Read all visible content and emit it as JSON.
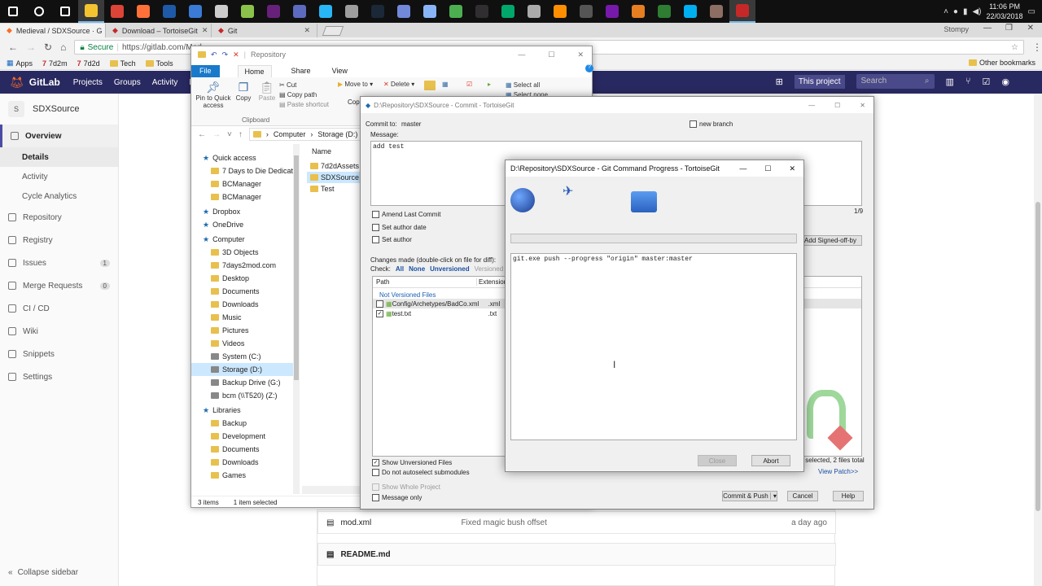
{
  "taskbar": {
    "icons": [
      {
        "name": "start-icon",
        "color": "#ffffff"
      },
      {
        "name": "search-icon",
        "color": "#ffffff"
      },
      {
        "name": "task-view-icon",
        "color": "#ffffff"
      },
      {
        "name": "file-explorer-icon",
        "color": "#f4c430"
      },
      {
        "name": "chrome-icon",
        "color": "#db4437"
      },
      {
        "name": "firefox-icon",
        "color": "#ff7139"
      },
      {
        "name": "app-blue-icon",
        "color": "#1e5aa8"
      },
      {
        "name": "thunderbird-icon",
        "color": "#3a7bd5"
      },
      {
        "name": "calculator-icon",
        "color": "#cccccc"
      },
      {
        "name": "notepad-plus-icon",
        "color": "#8bc34a"
      },
      {
        "name": "visual-studio-icon",
        "color": "#68217a"
      },
      {
        "name": "app-indigo-icon",
        "color": "#5c6bc0"
      },
      {
        "name": "app-cyan-icon",
        "color": "#29b6f6"
      },
      {
        "name": "app-grey-icon",
        "color": "#9e9e9e"
      },
      {
        "name": "steam-icon",
        "color": "#1b2838"
      },
      {
        "name": "discord-icon",
        "color": "#7289da"
      },
      {
        "name": "app-plane-icon",
        "color": "#8ab4f8"
      },
      {
        "name": "app-green-icon",
        "color": "#4caf50"
      },
      {
        "name": "obs-icon",
        "color": "#302e31"
      },
      {
        "name": "app-v-icon",
        "color": "#00a86b"
      },
      {
        "name": "tools-icon",
        "color": "#aaaaaa"
      },
      {
        "name": "app-orange-icon",
        "color": "#ff8f00"
      },
      {
        "name": "app-dark-icon",
        "color": "#555555"
      },
      {
        "name": "onenote-icon",
        "color": "#7719aa"
      },
      {
        "name": "app-slides-icon",
        "color": "#e67e22"
      },
      {
        "name": "app-green2-icon",
        "color": "#2e7d32"
      },
      {
        "name": "skype-icon",
        "color": "#00aff0"
      },
      {
        "name": "app-brown-icon",
        "color": "#8d6e63"
      },
      {
        "name": "tortoisegit-icon",
        "color": "#c62828"
      }
    ],
    "time": "11:06 PM",
    "date": "22/03/2018"
  },
  "browser": {
    "tabs": [
      {
        "label": "Medieval / SDXSource · G"
      },
      {
        "label": "Download – TortoiseGit"
      },
      {
        "label": "Git"
      }
    ],
    "profile": "Stompy",
    "secure_label": "Secure",
    "url": "https://gitlab.com/Med",
    "bookmarks": [
      "Apps",
      "7d2m",
      "7d2d",
      "Tech",
      "Tools"
    ],
    "other_bookmarks": "Other bookmarks"
  },
  "gitlab": {
    "brand": "GitLab",
    "nav": [
      "Projects",
      "Groups",
      "Activity",
      "Mile"
    ],
    "this_project": "This project",
    "search_placeholder": "Search",
    "project_initial": "S",
    "project_name": "SDXSource",
    "sidebar": [
      {
        "label": "Overview",
        "type": "main",
        "active": true
      },
      {
        "label": "Details",
        "type": "sub",
        "active": true
      },
      {
        "label": "Activity",
        "type": "sub"
      },
      {
        "label": "Cycle Analytics",
        "type": "sub"
      },
      {
        "label": "Repository",
        "type": "main"
      },
      {
        "label": "Registry",
        "type": "main"
      },
      {
        "label": "Issues",
        "type": "main",
        "count": "1"
      },
      {
        "label": "Merge Requests",
        "type": "main",
        "count": "0"
      },
      {
        "label": "CI / CD",
        "type": "main"
      },
      {
        "label": "Wiki",
        "type": "main"
      },
      {
        "label": "Snippets",
        "type": "main"
      },
      {
        "label": "Settings",
        "type": "main"
      }
    ],
    "collapse": "Collapse sidebar",
    "files": [
      {
        "name": "mod.xml",
        "commit": "Fixed magic bush offset",
        "time": "a day ago"
      }
    ],
    "readme": "README.md"
  },
  "explorer": {
    "title": "Repository",
    "ribbon_tabs": [
      "File",
      "Home",
      "Share",
      "View"
    ],
    "clipboard_label": "Clipboard",
    "ribbon_items": [
      "Pin to Quick access",
      "Copy",
      "Paste",
      "Cut",
      "Copy path",
      "Paste shortcut",
      "Move to",
      "Delete",
      "Select all",
      "Select none",
      "Cop"
    ],
    "path": [
      "Computer",
      "Storage (D:)",
      "R"
    ],
    "nav": [
      {
        "label": "Quick access",
        "root": true
      },
      {
        "label": "7 Days to Die Dedicate"
      },
      {
        "label": "BCManager"
      },
      {
        "label": "BCManager"
      },
      {
        "label": "Dropbox",
        "root": true
      },
      {
        "label": "OneDrive",
        "root": true
      },
      {
        "label": "Computer",
        "root": true
      },
      {
        "label": "3D Objects"
      },
      {
        "label": "7days2mod.com"
      },
      {
        "label": "Desktop"
      },
      {
        "label": "Documents"
      },
      {
        "label": "Downloads"
      },
      {
        "label": "Music"
      },
      {
        "label": "Pictures"
      },
      {
        "label": "Videos"
      },
      {
        "label": "System (C:)"
      },
      {
        "label": "Storage (D:)",
        "selected": true
      },
      {
        "label": "Backup Drive (G:)"
      },
      {
        "label": "bcm (\\\\T520) (Z:)"
      },
      {
        "label": "Libraries",
        "root": true
      },
      {
        "label": "Backup"
      },
      {
        "label": "Development"
      },
      {
        "label": "Documents"
      },
      {
        "label": "Downloads"
      },
      {
        "label": "Games"
      }
    ],
    "column_name": "Name",
    "items": [
      "7d2dAssets",
      "SDXSource",
      "Test"
    ],
    "status_items": "3 items",
    "status_selected": "1 item selected"
  },
  "commit": {
    "title": "D:\\Repository\\SDXSource - Commit - TortoiseGit",
    "commit_to_label": "Commit to:",
    "branch": "master",
    "new_branch": "new branch",
    "message_label": "Message:",
    "message": "add test",
    "counter": "1/9",
    "amend": "Amend Last Commit",
    "set_author_date": "Set author date",
    "set_author": "Set author",
    "add_signed": "Add Signed-off-by",
    "changes_label": "Changes made (double-click on file for diff):",
    "check_label": "Check:",
    "check_options": [
      "All",
      "None",
      "Unversioned",
      "Versioned"
    ],
    "col_path": "Path",
    "col_ext": "Extension",
    "group": "Not Versioned Files",
    "files": [
      {
        "path": "Config/Archetypes/BadCo.xml",
        "ext": ".xml"
      },
      {
        "path": "test.txt",
        "ext": ".txt"
      }
    ],
    "show_unversioned": "Show Unversioned Files",
    "no_autoselect": "Do not autoselect submodules",
    "show_whole": "Show Whole Project",
    "message_only": "Message only",
    "selected_summary": "s selected, 2 files total",
    "view_patch": "View Patch>>",
    "commit_push": "Commit & Push",
    "cancel": "Cancel",
    "help": "Help"
  },
  "progress": {
    "title": "D:\\Repository\\SDXSource - Git Command Progress - TortoiseGit",
    "output": "git.exe push --progress \"origin\" master:master",
    "close": "Close",
    "abort": "Abort"
  }
}
